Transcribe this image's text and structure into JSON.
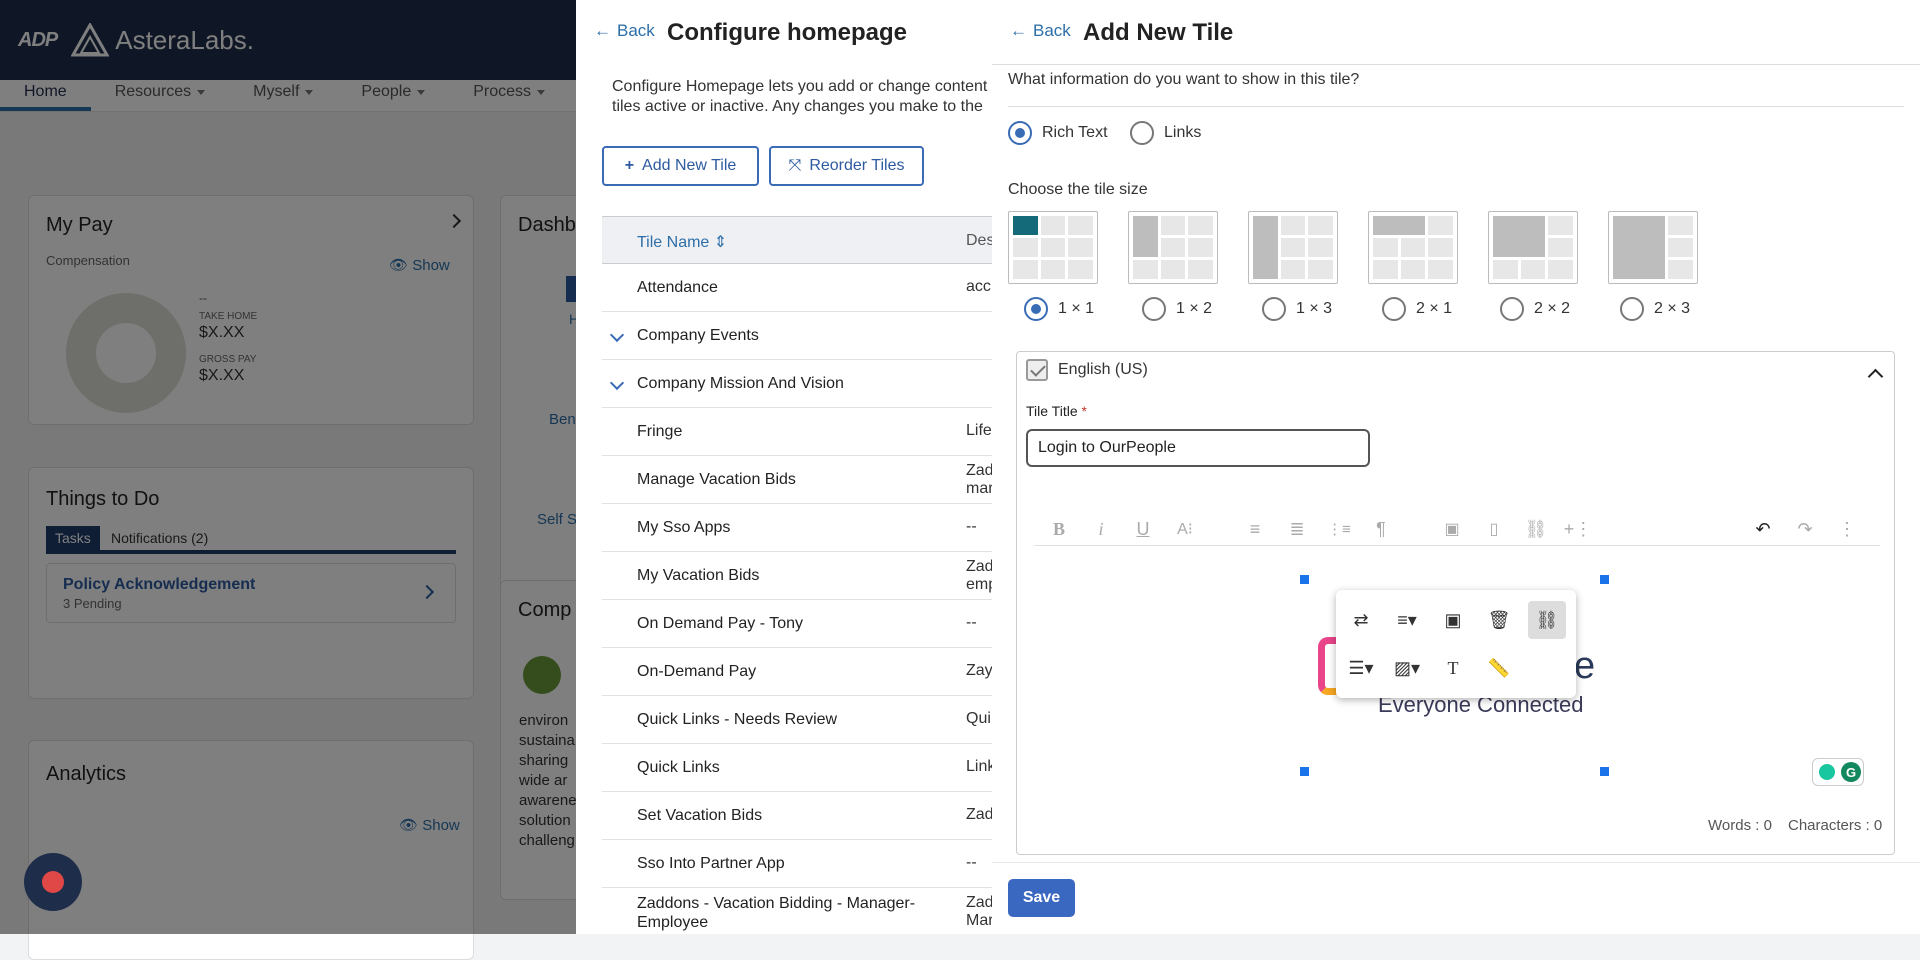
{
  "app": {
    "adp_logo": "ADP",
    "brand": "AsteraLabs."
  },
  "nav": {
    "items": [
      "Home",
      "Resources",
      "Myself",
      "People",
      "Process"
    ]
  },
  "mypay": {
    "title": "My Pay",
    "subtitle": "Compensation",
    "show_label": "Show",
    "dash": "--",
    "take_home_label": "TAKE HOME",
    "take_home_value": "$X.XX",
    "gross_label": "GROSS PAY",
    "gross_value": "$X.XX"
  },
  "todo": {
    "title": "Things to Do",
    "tabs": [
      "Tasks",
      "Notifications (2)"
    ],
    "item_title": "Policy Acknowledgement",
    "item_sub": "3 Pending"
  },
  "analytics": {
    "title": "Analytics",
    "show_label": "Show"
  },
  "dashboard": {
    "title": "Dashb",
    "h": "H",
    "ben": "Ben",
    "self": "Self S",
    "comp": "Comp",
    "text_lines": [
      "environ",
      "sustaina",
      "sharing",
      "wide ar",
      "awarene",
      "solution",
      "challeng"
    ]
  },
  "configure": {
    "back_label": "Back",
    "title": "Configure homepage",
    "desc_line1": "Configure Homepage lets you add or change content",
    "desc_line2": "tiles active or inactive. Any changes you make to the",
    "add_button": "Add New Tile",
    "reorder_button": "Reorder Tiles",
    "col_name": "Tile Name",
    "col_desc": "Des",
    "rows": [
      {
        "name": "Attendance",
        "desc": "acc"
      },
      {
        "name": "Company Events",
        "desc": ""
      },
      {
        "name": "Company Mission And Vision",
        "desc": ""
      },
      {
        "name": "Fringe",
        "desc": "Life"
      },
      {
        "name": "Manage Vacation Bids",
        "desc": "Zad"
      },
      {
        "name": "My Sso Apps",
        "desc": "--"
      },
      {
        "name": "My Vacation Bids",
        "desc": "Zad"
      },
      {
        "name": "On Demand Pay - Tony",
        "desc": "--"
      },
      {
        "name": "On-Demand Pay",
        "desc": "Zay"
      },
      {
        "name": "Quick Links - Needs Review",
        "desc": "Qui"
      },
      {
        "name": "Quick Links",
        "desc": "Link"
      },
      {
        "name": "Set Vacation Bids",
        "desc": "Zad"
      },
      {
        "name": "Sso Into Partner App",
        "desc": "--"
      },
      {
        "name": "Zaddons - Vacation Bidding - Manager-Employee",
        "desc": "Zad"
      }
    ],
    "desc_extra": {
      "manage": "mar",
      "myvac": "emp",
      "zaddons": "Mar"
    }
  },
  "add_tile": {
    "back_label": "Back",
    "title": "Add New Tile",
    "question": "What information do you want to show in this tile?",
    "content_types": [
      "Rich Text",
      "Links"
    ],
    "size_label": "Choose the tile size",
    "sizes": [
      "1 × 1",
      "1 × 2",
      "1 × 3",
      "2 × 1",
      "2 × 2",
      "2 × 3"
    ],
    "language": "English (US)",
    "tile_title_label": "Tile Title",
    "required_mark": "*",
    "tile_title_value": "Login to OurPeople",
    "image_text": "Everyone Connected",
    "image_partial": "e",
    "words_label": "Words : 0",
    "chars_label": "Characters : 0",
    "save_label": "Save"
  },
  "colors": {
    "accent": "#3a6bb5",
    "header": "#1e2d4a",
    "selected_tile": "#156a7a"
  }
}
